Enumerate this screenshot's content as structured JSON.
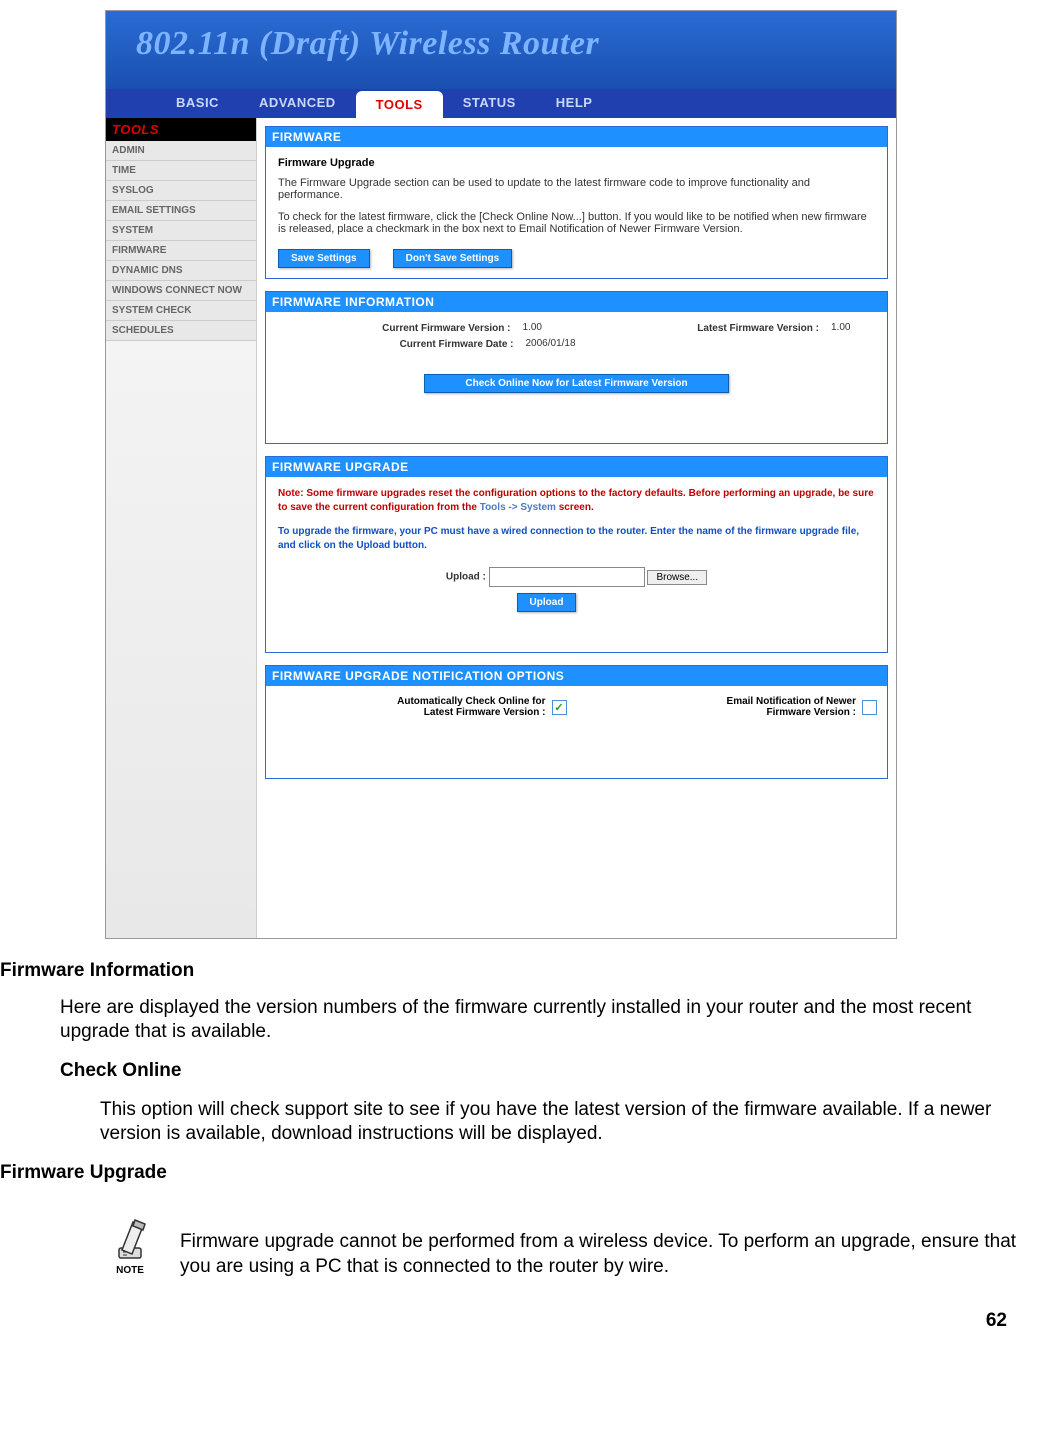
{
  "header_title": "802.11n (Draft) Wireless Router",
  "nav": {
    "basic": "BASIC",
    "advanced": "ADVANCED",
    "tools": "TOOLS",
    "status": "STATUS",
    "help": "HELP"
  },
  "sidebar": {
    "title": "TOOLS",
    "items": [
      "ADMIN",
      "TIME",
      "SYSLOG",
      "EMAIL SETTINGS",
      "SYSTEM",
      "FIRMWARE",
      "DYNAMIC DNS",
      "WINDOWS CONNECT NOW",
      "SYSTEM CHECK",
      "SCHEDULES"
    ]
  },
  "panels": {
    "firmware": {
      "hdr": "FIRMWARE",
      "sub": "Firmware Upgrade",
      "p1": "The Firmware Upgrade section can be used to update to the latest firmware code to improve functionality and performance.",
      "p2": "To check for the latest firmware, click the [Check Online Now...] button. If you would like to be notified when new firmware is released, place a checkmark in the box next to Email Notification of Newer Firmware Version.",
      "save_btn": "Save Settings",
      "dont_save_btn": "Don't Save Settings"
    },
    "info": {
      "hdr": "FIRMWARE INFORMATION",
      "cur_ver_lbl": "Current Firmware Version :",
      "cur_ver_val": "1.00",
      "latest_ver_lbl": "Latest Firmware Version :",
      "latest_ver_val": "1.00",
      "cur_date_lbl": "Current Firmware Date :",
      "cur_date_val": "2006/01/18",
      "check_btn": "Check Online Now for Latest Firmware Version"
    },
    "upgrade": {
      "hdr": "FIRMWARE UPGRADE",
      "note": "Note: Some firmware upgrades reset the configuration options to the factory defaults. Before performing an upgrade, be sure to save the current configuration from the ",
      "note_link": "Tools -> System",
      "note_tail": " screen.",
      "blue": "To upgrade the firmware, your PC must have a wired connection to the router. Enter the name of the firmware upgrade file, and click on the Upload button.",
      "upload_lbl": "Upload :",
      "browse_btn": "Browse...",
      "upload_btn": "Upload"
    },
    "notif": {
      "hdr": "FIRMWARE UPGRADE NOTIFICATION OPTIONS",
      "auto_lbl1": "Automatically Check Online for",
      "auto_lbl2": "Latest Firmware Version :",
      "email_lbl1": "Email Notification of Newer",
      "email_lbl2": "Firmware Version :"
    }
  },
  "doc": {
    "h_fw_info": "Firmware Information",
    "p_fw_info": "Here are displayed the version numbers of the firmware currently installed in your router and the most recent upgrade that is available.",
    "h_check": "Check Online",
    "p_check": "This option will check support site to see if you have the latest version of the firmware available. If a newer version is available, download instructions will be displayed.",
    "h_fw_up": "Firmware Upgrade",
    "note_label": "NOTE",
    "p_note": "Firmware upgrade cannot be performed from a wireless device. To perform an upgrade, ensure that you are using a PC that is connected to the router by wire."
  },
  "page_no": "62"
}
